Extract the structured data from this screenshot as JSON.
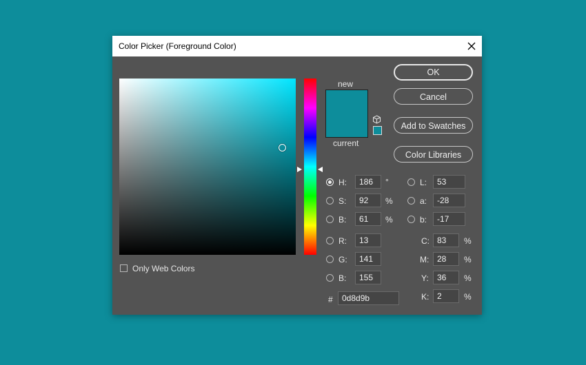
{
  "dialog": {
    "title": "Color Picker (Foreground Color)"
  },
  "colors": {
    "new_color": "#0d8d9b",
    "current_color": "#0d8d9b",
    "hue_pure": "#00e5ff"
  },
  "swatch": {
    "new_label": "new",
    "current_label": "current"
  },
  "buttons": {
    "ok": "OK",
    "cancel": "Cancel",
    "add_to_swatches": "Add to Swatches",
    "color_libraries": "Color Libraries"
  },
  "only_web_colors": {
    "label": "Only Web Colors",
    "checked": false
  },
  "hsb": {
    "h": {
      "label": "H:",
      "value": "186",
      "unit": "°",
      "selected": true
    },
    "s": {
      "label": "S:",
      "value": "92",
      "unit": "%"
    },
    "b": {
      "label": "B:",
      "value": "61",
      "unit": "%"
    }
  },
  "rgb": {
    "r": {
      "label": "R:",
      "value": "13"
    },
    "g": {
      "label": "G:",
      "value": "141"
    },
    "b": {
      "label": "B:",
      "value": "155"
    }
  },
  "lab": {
    "l": {
      "label": "L:",
      "value": "53"
    },
    "a": {
      "label": "a:",
      "value": "-28"
    },
    "b": {
      "label": "b:",
      "value": "-17"
    }
  },
  "cmyk": {
    "c": {
      "label": "C:",
      "value": "83",
      "unit": "%"
    },
    "m": {
      "label": "M:",
      "value": "28",
      "unit": "%"
    },
    "y": {
      "label": "Y:",
      "value": "36",
      "unit": "%"
    },
    "k": {
      "label": "K:",
      "value": "2",
      "unit": "%"
    }
  },
  "hex": {
    "label": "#",
    "value": "0d8d9b"
  },
  "icons": {
    "close": "close-icon",
    "gamut": "cube-icon"
  }
}
